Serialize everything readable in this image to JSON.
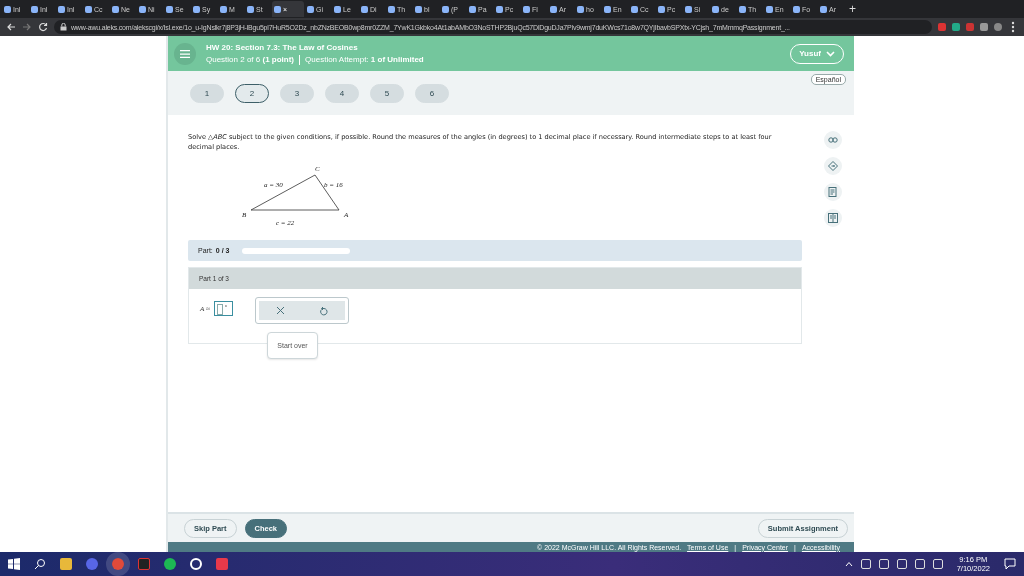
{
  "browser": {
    "tabs": [
      {
        "label": "Inl",
        "selected": false
      },
      {
        "label": "Inl",
        "selected": false
      },
      {
        "label": "Inl",
        "selected": false
      },
      {
        "label": "Cc",
        "selected": false
      },
      {
        "label": "Ne",
        "selected": false
      },
      {
        "label": "Ni",
        "selected": false
      },
      {
        "label": "Se",
        "selected": false
      },
      {
        "label": "Sy",
        "selected": false
      },
      {
        "label": "M",
        "selected": false
      },
      {
        "label": "St",
        "selected": false
      },
      {
        "close": "×",
        "selected": true
      },
      {
        "label": "Gi",
        "selected": false
      },
      {
        "label": "Le",
        "selected": false
      },
      {
        "label": "Di",
        "selected": false
      },
      {
        "label": "Th",
        "selected": false
      },
      {
        "label": "bl",
        "selected": false
      },
      {
        "label": "(P",
        "selected": false
      },
      {
        "label": "Pa",
        "selected": false
      },
      {
        "label": "Pc",
        "selected": false
      },
      {
        "label": "Fl",
        "selected": false
      },
      {
        "label": "Ar",
        "selected": false
      },
      {
        "label": "ho",
        "selected": false
      },
      {
        "label": "En",
        "selected": false
      },
      {
        "label": "Cc",
        "selected": false
      },
      {
        "label": "Pc",
        "selected": false
      },
      {
        "label": "Si",
        "selected": false
      },
      {
        "label": "de",
        "selected": false
      },
      {
        "label": "Th",
        "selected": false
      },
      {
        "label": "En",
        "selected": false
      },
      {
        "label": "Fo",
        "selected": false
      },
      {
        "label": "Ar",
        "selected": false
      }
    ],
    "new_tab": "+",
    "url": "www-awu.aleks.com/alekscgi/x/Isl.exe/1o_u-IgNslkr7j8P3jH-lBgu5pl7HuR5O2Dz_nbZNzBEOB0wp8mr0ZZM_7YwK1Gkbko4At1abAMbO3NoSTHP2BjuQc57DlDguDJa7Plv9wmj7duKWcs71o8w7QYjIbavbSPXtx-YCjsh_7mMmmqPassignment_..."
  },
  "header": {
    "title": "HW 20: Section 7.3: The Law of Cosines",
    "question": "Question 2 of 6 **(1 point)**",
    "attempt": "Question Attempt: **1 of Unlimited**",
    "user": "Yusuf"
  },
  "language": "Español",
  "questions": [
    {
      "label": "1",
      "selected": false
    },
    {
      "label": "2",
      "selected": true
    },
    {
      "label": "3",
      "selected": false
    },
    {
      "label": "4",
      "selected": false
    },
    {
      "label": "5",
      "selected": false
    },
    {
      "label": "6",
      "selected": false
    }
  ],
  "problem": {
    "text": "Solve △*ABC* subject to the given conditions, if possible. Round the measures of the angles (in degrees) to 1 decimal place if necessary. Round intermediate steps to at least four decimal places.",
    "vertices": [
      "C",
      "B",
      "A"
    ],
    "sides": [
      "a = 30",
      "b = 16",
      "c = 22"
    ]
  },
  "progress": {
    "label": "Part:",
    "value": "0 / 3",
    "level": 0
  },
  "part": {
    "title": "Part 1 of 3",
    "variable": "A ≈",
    "unit": "°",
    "tooltip": "Start over"
  },
  "actions": {
    "skip": "Skip Part",
    "check": "Check",
    "submit": "Submit Assignment"
  },
  "footer": {
    "copyright": "© 2022 McGraw Hill LLC. All Rights Reserved.",
    "links": [
      "Terms of Use",
      "Privacy Center",
      "Accessibility"
    ],
    "separators": [
      "|",
      "|"
    ]
  },
  "taskbar": {
    "time": "9:16 PM",
    "date": "7/10/2022"
  }
}
